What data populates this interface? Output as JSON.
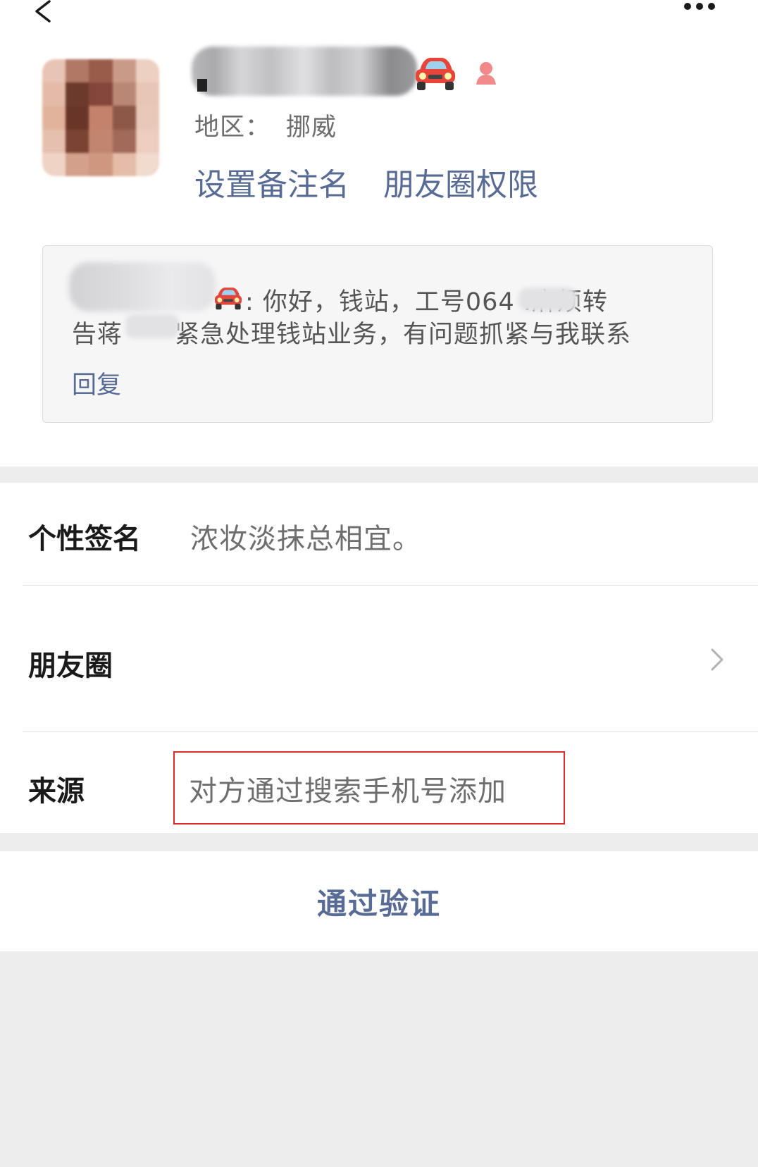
{
  "nav": {
    "back_icon": "chevron-left-icon",
    "more_icon": "more-dots-icon"
  },
  "profile": {
    "region_label": "地区：",
    "region_value": "挪威",
    "set_remark_label": "设置备注名",
    "moments_permission_label": "朋友圈权限",
    "name_emoji": "🚘",
    "gender_icon": "female-icon"
  },
  "message": {
    "line1": ": 你好，钱站，工号064    .麻烦转",
    "line2_prefix": "告蒋",
    "line2_suffix": "紧急处理钱站业务，有问题抓紧与我联系",
    "reply_label": "回复"
  },
  "details": {
    "signature_label": "个性签名",
    "signature_value": "浓妆淡抹总相宜。",
    "moments_label": "朋友圈",
    "source_label": "来源",
    "source_value": "对方通过搜索手机号添加"
  },
  "action": {
    "verify_label": "通过验证"
  },
  "colors": {
    "link": "#586b95",
    "highlight_border": "#e02b2b",
    "background": "#ededed",
    "car_red": "#e8443a"
  }
}
